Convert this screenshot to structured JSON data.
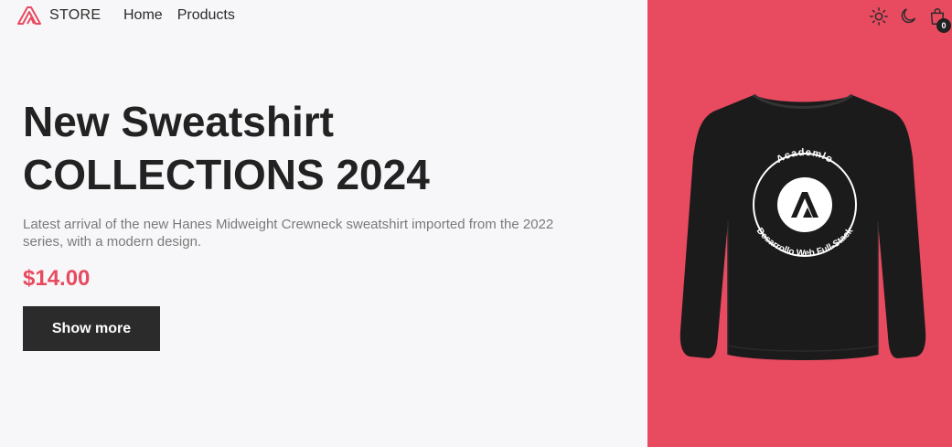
{
  "header": {
    "brand_name": "STORE",
    "nav": [
      "Home",
      "Products"
    ],
    "cart_count": "0"
  },
  "hero": {
    "title_line1": "New Sweatshirt",
    "title_line2": "COLLECTIONS 2024",
    "description": "Latest arrival of the new Hanes Midweight Crewneck sweatshirt imported from the 2022 series, with a modern design.",
    "price": "$14.00",
    "cta_label": "Show more"
  },
  "product_image": {
    "print_top": "Academlo",
    "print_bottom": "Desarrollo Web Full-Stack"
  },
  "colors": {
    "accent": "#e84a5f",
    "dark": "#2b2b2b",
    "background": "#f7f7f9"
  },
  "icons": [
    "logo-icon",
    "sun-icon",
    "moon-icon",
    "shopping-bag-icon"
  ]
}
